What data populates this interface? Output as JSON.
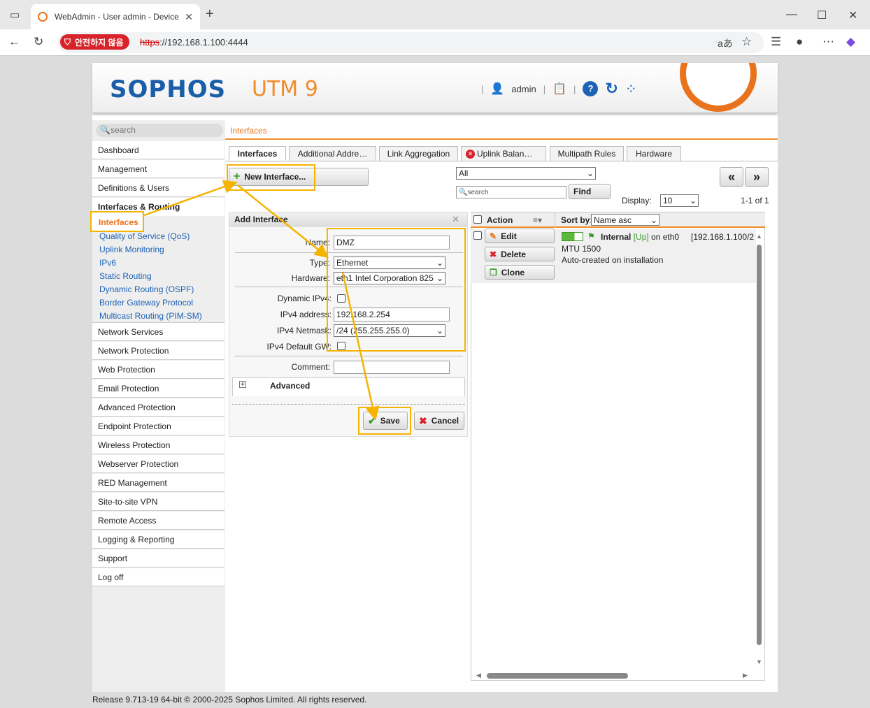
{
  "browser": {
    "tab_title": "WebAdmin - User admin - Device",
    "security_label": "안전하지 않음",
    "url_scheme": "https",
    "url_rest": "://192.168.1.100:4444"
  },
  "header": {
    "logo": "SOPHOS",
    "product": "UTM 9",
    "user": "admin"
  },
  "sidebar": {
    "search_placeholder": "search",
    "items": [
      "Dashboard",
      "Management",
      "Definitions & Users",
      "Interfaces & Routing"
    ],
    "active": "Interfaces",
    "subitems": [
      "Quality of Service (QoS)",
      "Uplink Monitoring",
      "IPv6",
      "Static Routing",
      "Dynamic Routing (OSPF)",
      "Border Gateway Protocol",
      "Multicast Routing (PIM-SM)"
    ],
    "items_after": [
      "Network Services",
      "Network Protection",
      "Web Protection",
      "Email Protection",
      "Advanced Protection",
      "Endpoint Protection",
      "Wireless Protection",
      "Webserver Protection",
      "RED Management",
      "Site-to-site VPN",
      "Remote Access",
      "Logging & Reporting",
      "Support",
      "Log off"
    ]
  },
  "breadcrumb": "Interfaces",
  "tabs": [
    "Interfaces",
    "Additional Addre…",
    "Link Aggregation",
    "Uplink Balan…",
    "Multipath Rules",
    "Hardware"
  ],
  "toolbar": {
    "new_interface": "New Interface...",
    "filter_value": "All",
    "search_placeholder": "search",
    "find": "Find",
    "display_label": "Display:",
    "display_value": "10",
    "paging": "1-1 of 1",
    "prev": "«",
    "next": "»"
  },
  "form": {
    "title": "Add Interface",
    "name_label": "Name:",
    "name_value": "DMZ",
    "type_label": "Type:",
    "type_value": "Ethernet",
    "hardware_label": "Hardware:",
    "hardware_value": "eth1 Intel Corporation 825",
    "dyn_ipv4_label": "Dynamic IPv4:",
    "ipv4_addr_label": "IPv4 address:",
    "ipv4_addr_value": "192.168.2.254",
    "netmask_label": "IPv4 Netmask:",
    "netmask_value": "/24 (255.255.255.0)",
    "default_gw_label": "IPv4 Default GW:",
    "comment_label": "Comment:",
    "advanced": "Advanced",
    "save": "Save",
    "cancel": "Cancel"
  },
  "list": {
    "action_header": "Action",
    "sortby_label": "Sort by:",
    "sortby_value": "Name asc",
    "edit": "Edit",
    "delete": "Delete",
    "clone": "Clone",
    "row_name": "Internal",
    "row_status": "[Up]",
    "row_on": "on eth0",
    "row_ip": "[192.168.1.100/2",
    "row_mtu": "MTU 1500",
    "row_desc": "Auto-created on installation"
  },
  "footer": "Release 9.713-19 64-bit  © 2000-2025 Sophos Limited. All rights reserved.",
  "colors": {
    "accent": "#f28c28",
    "highlight": "#f4b400",
    "brand": "#1b5ea8"
  }
}
